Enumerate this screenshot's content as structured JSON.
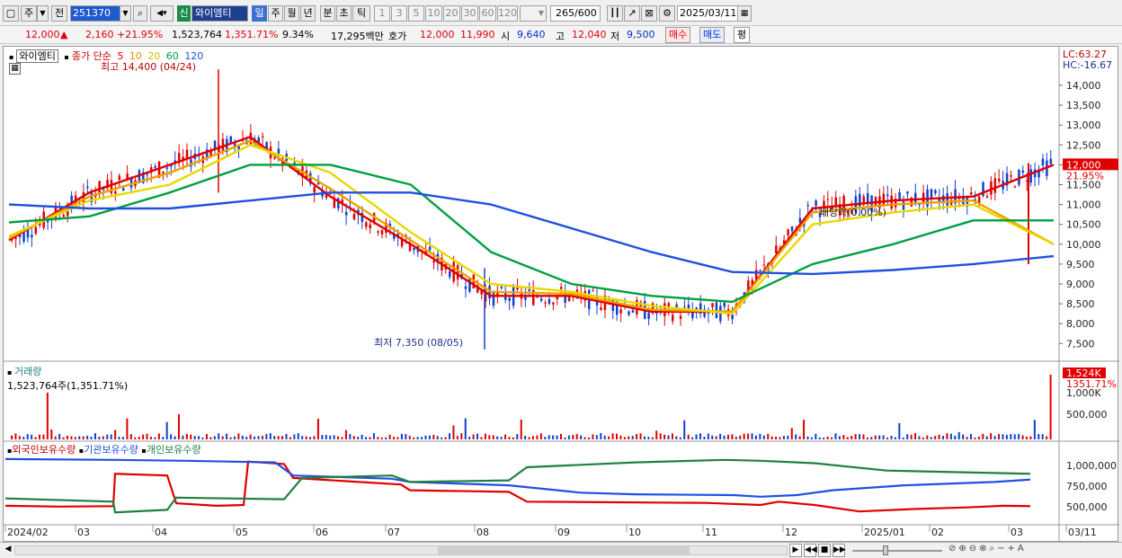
{
  "toolbar": {
    "period_label": "주",
    "prev_label": "전",
    "code": "251370",
    "shin_badge": "신",
    "stock_name": "와이엠티",
    "periods": [
      "일",
      "주",
      "월",
      "년",
      "분",
      "초",
      "틱"
    ],
    "intervals": [
      "1",
      "3",
      "5",
      "10",
      "20",
      "30",
      "60",
      "120"
    ],
    "count": "265",
    "count_max": "/600",
    "date": "2025/03/11"
  },
  "quote": {
    "price": "12,000",
    "up_arrow": "▲",
    "change": "2,160",
    "change_pct": "+21.95%",
    "volume": "1,523,764",
    "vol_pct": "1,351.71%",
    "turnover": "9.34%",
    "amount": "17,295백만",
    "hoga_label": "호가",
    "ask": "12,000",
    "bid": "11,990",
    "open_label": "시",
    "open": "9,640",
    "high_label": "고",
    "high": "12,040",
    "low_label": "저",
    "low": "9,500",
    "buy_label": "매수",
    "sell_label": "매도",
    "eval_label": "평"
  },
  "legend": {
    "stock_name": "와이엠티",
    "ma_label": "종가 단순",
    "ma_periods": [
      "5",
      "10",
      "20",
      "60",
      "120"
    ],
    "ma_colors": [
      "#e00000",
      "#f0a000",
      "#e8d800",
      "#00a040",
      "#2050e0"
    ],
    "high_annot": "최고 14,400 (04/24)",
    "low_annot": "최저 7,350 (08/05)",
    "dividend_annot": "배당락(0.00%)",
    "lc": "LC:63.27",
    "hc": "HC:-16.67",
    "last_price": "12,000",
    "last_pct": "21.95%"
  },
  "volume_panel": {
    "title": "거래량",
    "value_text": "1,523,764주(1,351.71%)",
    "last_tag": "1,524K",
    "last_pct": "1351.71%",
    "y_labels": [
      "1,000K",
      "500,000"
    ]
  },
  "investor_panel": {
    "labels": [
      "외국인보유수량",
      "기관보유수량",
      "개인보유수량"
    ],
    "colors": [
      "#e00000",
      "#2050e0",
      "#208040"
    ],
    "y_labels": [
      "1,000,000",
      "750,000",
      "500,000"
    ]
  },
  "price_axis": [
    "14,000",
    "13,500",
    "13,000",
    "12,500",
    "12,000",
    "11,500",
    "11,000",
    "10,500",
    "10,000",
    "9,500",
    "9,000",
    "8,500",
    "8,000",
    "7,500"
  ],
  "x_axis": [
    "2024/02",
    "03",
    "04",
    "05",
    "06",
    "07",
    "08",
    "09",
    "10",
    "11",
    "12",
    "2025/01",
    "02",
    "03",
    "03/11"
  ],
  "chart_data": {
    "type": "line",
    "title": "",
    "x": [
      "2024/02",
      "03",
      "04",
      "05",
      "06",
      "07",
      "08",
      "09",
      "10",
      "11",
      "12",
      "2025/01",
      "02",
      "03"
    ],
    "ylim": [
      7100,
      14700
    ],
    "series": [
      {
        "name": "5",
        "values": [
          10100,
          11300,
          12000,
          12700,
          11200,
          10000,
          8700,
          8700,
          8300,
          8300,
          10900,
          11100,
          11200,
          12000
        ]
      },
      {
        "name": "10",
        "values": [
          10150,
          11200,
          11800,
          12600,
          11400,
          10100,
          8800,
          8750,
          8350,
          8300,
          10800,
          11000,
          11100,
          10000
        ]
      },
      {
        "name": "20",
        "values": [
          10200,
          11100,
          11500,
          12500,
          11800,
          10300,
          9000,
          8800,
          8450,
          8250,
          10500,
          10800,
          11000,
          10000
        ]
      },
      {
        "name": "60",
        "values": [
          10550,
          10700,
          11300,
          12000,
          12000,
          11500,
          9800,
          9000,
          8700,
          8550,
          9500,
          10000,
          10600,
          10600
        ]
      },
      {
        "name": "120",
        "values": [
          11000,
          10900,
          10900,
          11100,
          11300,
          11300,
          11000,
          10400,
          9800,
          9300,
          9250,
          9350,
          9500,
          9700
        ]
      }
    ]
  }
}
